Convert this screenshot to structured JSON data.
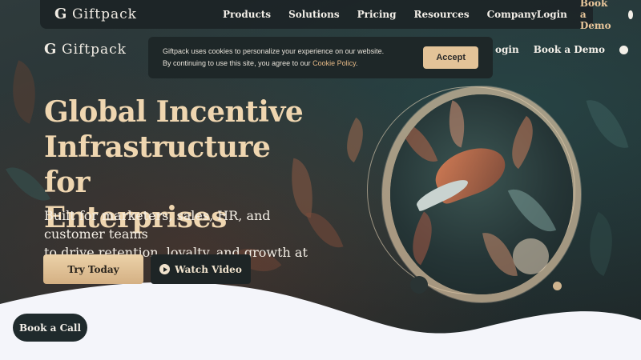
{
  "brand": {
    "name": "Giftpack"
  },
  "topnav": {
    "links": [
      "Products",
      "Solutions",
      "Pricing",
      "Resources",
      "Company"
    ],
    "login": "Login",
    "demo": "Book a Demo"
  },
  "subnav": {
    "login_partial": "ogin",
    "demo": "Book a Demo"
  },
  "cookie": {
    "line1": "Giftpack uses cookies to personalize your experience on our website.",
    "line2_prefix": "By continuing to use this site, you agree to our ",
    "link": "Cookie Policy",
    "line2_suffix": ".",
    "accept": "Accept"
  },
  "hero": {
    "title_line1": "Global Incentive",
    "title_line2": "Infrastructure for",
    "title_line3": "Enterprises",
    "sub_line1": "Built for marketers, sales, HR, and customer teams",
    "sub_line2": "to drive retention, loyalty, and growth at scale",
    "try": "Try Today",
    "video": "Watch Video"
  },
  "float": {
    "book_call": "Book a Call"
  },
  "colors": {
    "accent": "#e3c398",
    "title": "#efd6b0",
    "dark": "#1e2526"
  }
}
